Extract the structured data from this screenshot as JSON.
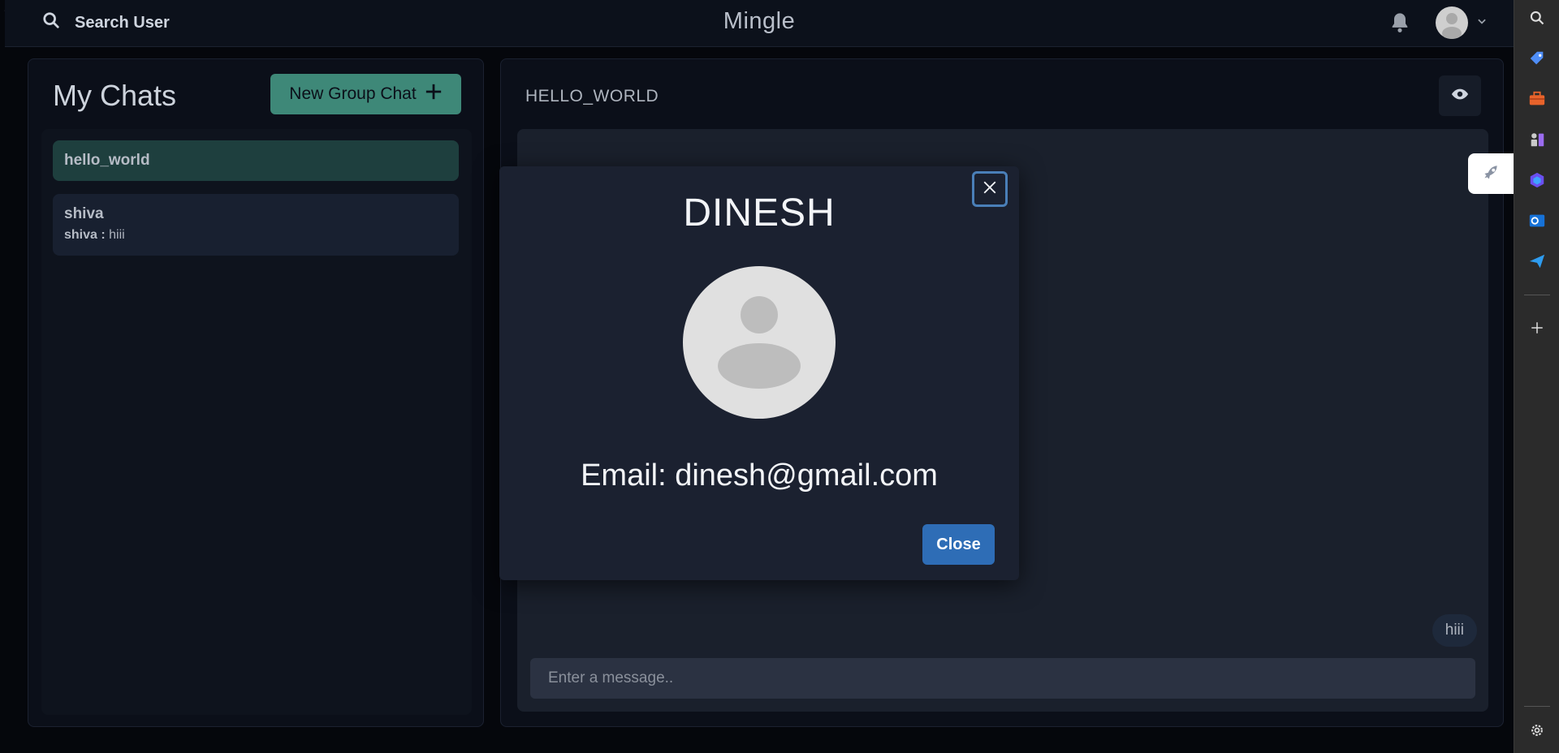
{
  "corner_text": "/*",
  "topbar": {
    "search_label": "Search User",
    "app_title": "Mingle",
    "icons": {
      "search": "search-icon",
      "bell": "bell-icon",
      "avatar": "avatar",
      "chevron": "chevron-down-icon"
    }
  },
  "chats": {
    "title": "My Chats",
    "new_group_label": "New Group Chat",
    "items": [
      {
        "name": "hello_world",
        "active": true
      },
      {
        "name": "shiva",
        "preview_sender": "shiva :",
        "preview_text": "hiii",
        "active": false
      }
    ]
  },
  "conversation": {
    "title": "HELLO_WORLD",
    "messages": [
      {
        "text": "hiii",
        "own": true
      }
    ],
    "input_placeholder": "Enter a message.."
  },
  "modal": {
    "title": "DINESH",
    "email_line": "Email: dinesh@gmail.com",
    "close_label": "Close"
  },
  "edge_sidebar": {
    "icons": [
      "search-icon",
      "tag-icon",
      "toolbox-icon",
      "chess-icon",
      "copilot-icon",
      "outlook-icon",
      "send-icon",
      "add-icon",
      "settings-icon"
    ],
    "active": "rocket-icon"
  },
  "colors": {
    "accent": "#3e8878",
    "primary_button": "#2e6db6",
    "active_chat": "#1e3f3e",
    "panel_bg": "#0b0f19",
    "modal_bg": "#1b2130"
  }
}
